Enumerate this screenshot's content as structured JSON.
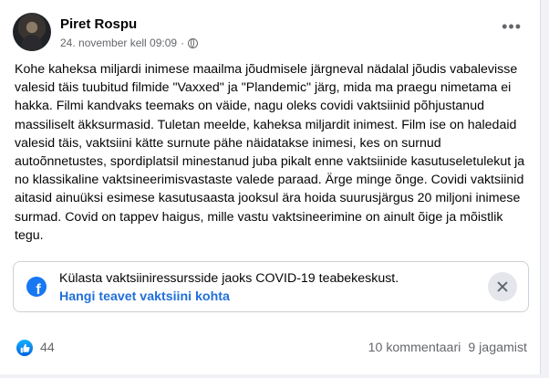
{
  "post": {
    "author": "Piret Rospu",
    "timestamp": "24. november kell 09:09",
    "separator": "·",
    "text": "Kohe kaheksa miljardi inimese maailma jõudmisele järgneval nädalal jõudis vabalevisse valesid täis tuubitud filmide \"Vaxxed\" ja \"Plandemic\" järg, mida ma praegu nimetama ei hakka. Filmi kandvaks teemaks on väide, nagu oleks covidi vaktsiinid põhjustanud massiliselt äkksurmasid. Tuletan meelde, kaheksa miljardit inimest. Film ise on haledaid valesid täis, vaktsiini kätte surnute pähe näidatakse inimesi, kes on surnud autoõnnetustes, spordiplatsil minestanud juba pikalt enne vaktsiinide kasutuseletulekut ja no klassikaline vaktsineerimisvastaste valede paraad. Ärge minge õnge. Covidi vaktsiinid aitasid ainuüksi esimese kasutusaasta jooksul ära hoida suurusjärgus 20 miljoni inimese surmad. Covid on tappev haigus, mille vastu vaktsineerimine on ainult õige ja mõistlik tegu."
  },
  "info_box": {
    "text": "Külasta vaktsiiniressursside jaoks COVID-19 teabekeskust.",
    "link": "Hangi teavet vaktsiini kohta",
    "fb_glyph": "f"
  },
  "footer": {
    "like_count": "44",
    "comments": "10 kommentaari",
    "shares": "9 jagamist"
  },
  "icons": {
    "globe": "globe-icon",
    "more": "more-icon",
    "facebook": "facebook-icon",
    "close": "close-icon",
    "like": "like-icon"
  },
  "colors": {
    "link": "#216fdb",
    "facebook_blue": "#1877f2",
    "secondary_text": "#65676b"
  }
}
